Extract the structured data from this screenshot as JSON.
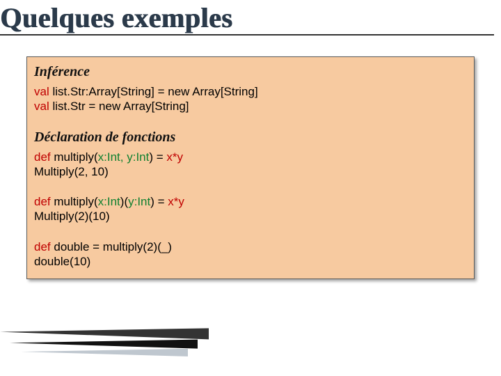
{
  "title": "Quelques exemples",
  "sections": {
    "inference": {
      "heading": "Inférence",
      "line1": {
        "kw": "val",
        "rest": " list.Str:Array[String] = new Array[String]"
      },
      "line2": {
        "kw": "val",
        "rest": " list.Str = new Array[String]"
      }
    },
    "functions": {
      "heading": "Déclaration de fonctions",
      "block1": {
        "line1": {
          "kw": "def",
          "name": " multiply(",
          "params": "x:Int, y:Int",
          "mid": ") = ",
          "expr": "x*y"
        },
        "line2": "Multiply(2, 10)"
      },
      "block2": {
        "line1": {
          "kw": "def",
          "name": " multiply(",
          "p1": "x:Int",
          "mid1": ")(",
          "p2": "y:Int",
          "mid2": ") = ",
          "expr": "x*y"
        },
        "line2": "Multiply(2)(10)"
      },
      "block3": {
        "line1": {
          "kw": "def",
          "rest": " double = multiply(2)(_)"
        },
        "line2": "double(10)"
      }
    }
  }
}
